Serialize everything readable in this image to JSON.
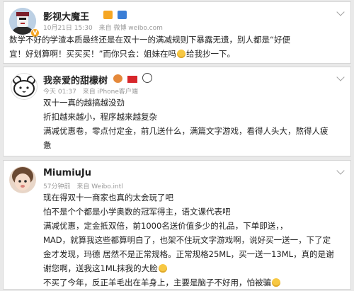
{
  "posts": [
    {
      "user": "影视大魔王",
      "time": "10月21日 15:30",
      "source": "来自 微博 weibo.com",
      "lines": [
        "数学不好的学渣本质最终还是在双十一的满减规则下暴露无遗，别人都是“好便",
        "宜！好划算啊！买买买！”而你只会：姐妹在吗",
        "给我抄一下。"
      ]
    },
    {
      "user": "我亲爱的甜檬树",
      "time": "今天 01:37",
      "source": "来自 iPhone客户端",
      "lines": [
        "双十一真的越搞越没劲",
        "折扣越来越小，程序越来越复杂",
        "满减优惠卷，零点付定金，前几送什么，满篇文字游戏，看得人头大，熬得人疲",
        "惫"
      ]
    },
    {
      "user": "MiumiuJu",
      "time": "57分钟前",
      "source": "来自 Weibo.intl",
      "lines": [
        "现在得双十一商家也真的太会玩了吧",
        "怕不是个个都是小学奥数的冠军得主，语文课代表吧",
        "满减优惠，定金抵双倍，前1000名送价值多少的礼品，下单即送，，",
        "MAD，就算我这些都算明白了，也架不住玩文字游戏啊，说好买一送一，下了定",
        "金才发现，玛德 居然不是正常规格。正常规格25ML，买一送一13ML，真的是谢",
        "谢您啊，送我这1ML抹我的大脸",
        "不买了今年，反正羊毛出在羊身上，主要是脑子不好用，怕被骗"
      ]
    }
  ],
  "colors": {
    "badge": "#f5a623",
    "meta": "#999999"
  }
}
